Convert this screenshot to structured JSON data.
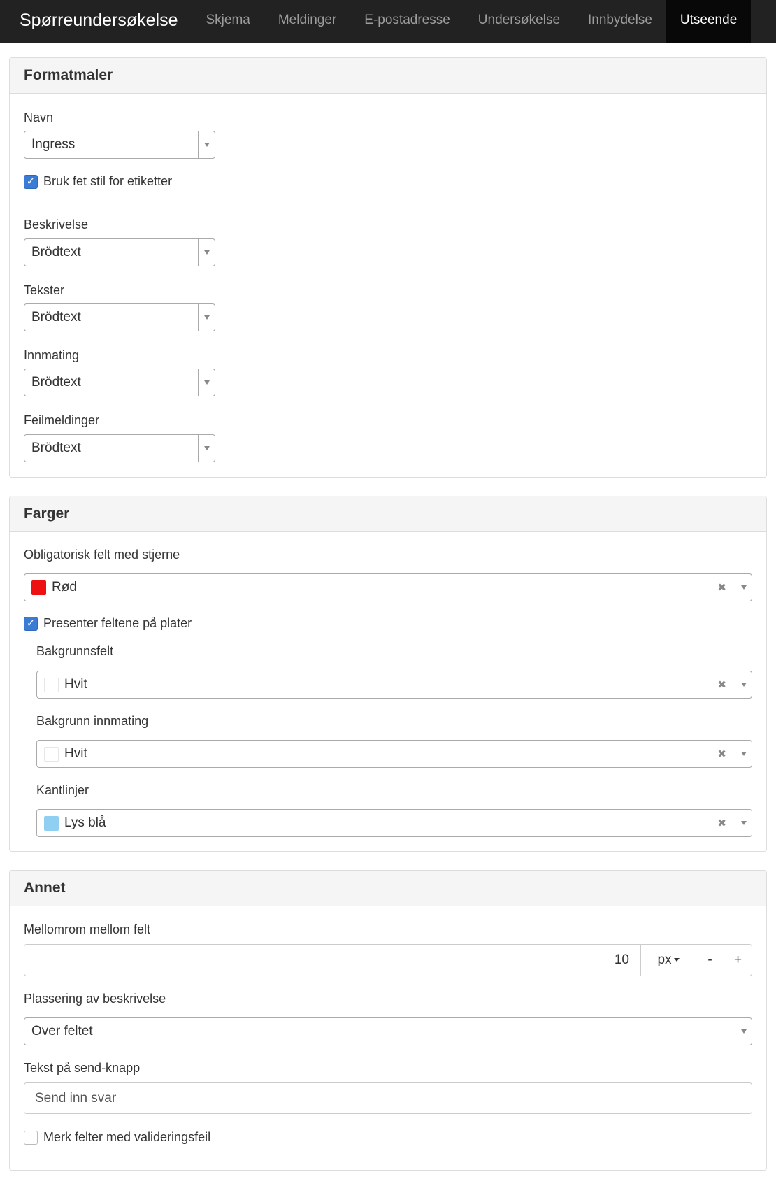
{
  "navbar": {
    "brand": "Spørreundersøkelse",
    "items": [
      "Skjema",
      "Meldinger",
      "E-postadresse",
      "Undersøkelse",
      "Innbydelse",
      "Utseende"
    ]
  },
  "formatmaler": {
    "title": "Formatmaler",
    "navn_label": "Navn",
    "navn_value": "Ingress",
    "bold_labels": "Bruk fet stil for etiketter",
    "beskrivelse_label": "Beskrivelse",
    "beskrivelse_value": "Brödtext",
    "tekster_label": "Tekster",
    "tekster_value": "Brödtext",
    "innmating_label": "Innmating",
    "innmating_value": "Brödtext",
    "feilmeldinger_label": "Feilmeldinger",
    "feilmeldinger_value": "Brödtext"
  },
  "farger": {
    "title": "Farger",
    "required_label": "Obligatorisk felt med stjerne",
    "required_value": "Rød",
    "required_color": "#ee1111",
    "plates_label": "Presenter feltene på plater",
    "bg_field_label": "Bakgrunnsfelt",
    "bg_field_value": "Hvit",
    "bg_input_label": "Bakgrunn innmating",
    "bg_input_value": "Hvit",
    "white_color": "#ffffff",
    "borders_label": "Kantlinjer",
    "borders_value": "Lys blå",
    "lightblue_color": "#8fd0f2"
  },
  "annet": {
    "title": "Annet",
    "spacing_label": "Mellomrom mellom felt",
    "spacing_value": "10",
    "spacing_unit": "px",
    "minus": "-",
    "plus": "+",
    "placement_label": "Plassering av beskrivelse",
    "placement_value": "Over feltet",
    "send_label": "Tekst på send-knapp",
    "send_value": "Send inn svar",
    "validation_label": "Merk felter med valideringsfeil"
  },
  "colors": {
    "navbar_bg": "#222222",
    "checkbox": "#3a7bd5"
  }
}
